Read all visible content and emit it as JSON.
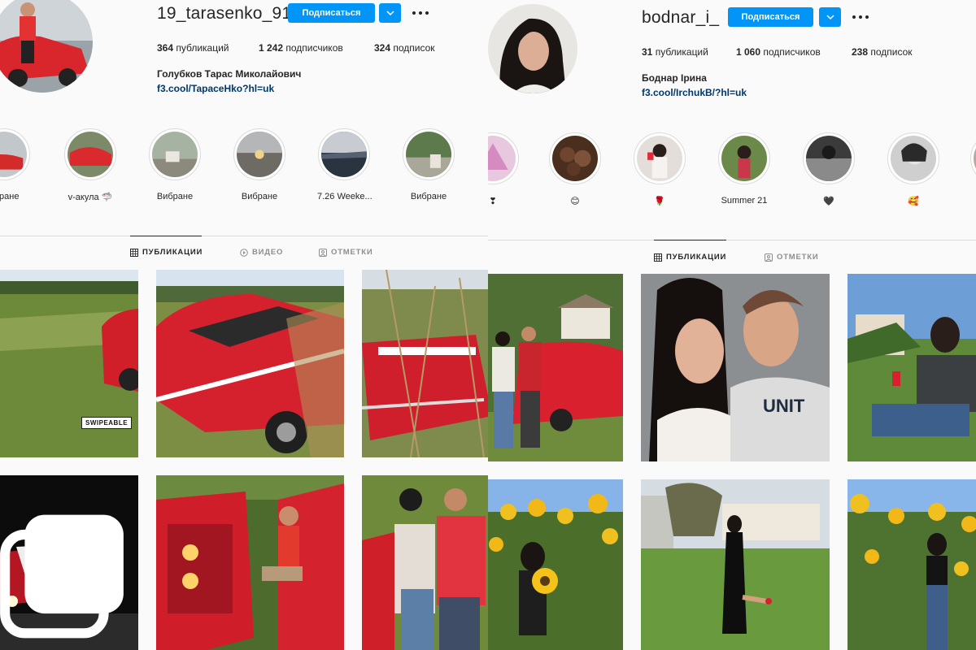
{
  "left": {
    "username": "19_tarasenko_91",
    "follow_label": "Подписаться",
    "stats": [
      {
        "value": "364",
        "label": "публикаций"
      },
      {
        "value": "1 242",
        "label": "подписчиков"
      },
      {
        "value": "324",
        "label": "подписок"
      }
    ],
    "full_name": "Голубков Тарас Миколайович",
    "bio_link": "f3.cool/TapaceHko?hl=uk",
    "highlights": [
      {
        "label": "ибране"
      },
      {
        "label": "v-акула 🦈"
      },
      {
        "label": "Вибране"
      },
      {
        "label": "Вибране"
      },
      {
        "label": "7.26 Weeke..."
      },
      {
        "label": "Вибране"
      }
    ],
    "tabs": [
      {
        "label": "ПУБЛИКАЦИИ",
        "icon": "grid-icon",
        "active": true
      },
      {
        "label": "ВИДЕО",
        "icon": "video-icon",
        "active": false
      },
      {
        "label": "ОТМЕТКИ",
        "icon": "tag-icon",
        "active": false
      }
    ],
    "sticker": "SWIPEABLE"
  },
  "right": {
    "username": "bodnar_i_",
    "follow_label": "Подписаться",
    "stats": [
      {
        "value": "31",
        "label": "публикаций"
      },
      {
        "value": "1 060",
        "label": "подписчиков"
      },
      {
        "value": "238",
        "label": "подписок"
      }
    ],
    "full_name": "Боднар Ірина",
    "bio_link": "f3.cool/IrchukB/?hl=uk",
    "highlights": [
      {
        "label": "❣"
      },
      {
        "label": "😊"
      },
      {
        "label": "🌹"
      },
      {
        "label": "Summer 21"
      },
      {
        "label": "🖤"
      },
      {
        "label": "🥰"
      }
    ],
    "tabs": [
      {
        "label": "ПУБЛИКАЦИИ",
        "icon": "grid-icon",
        "active": true
      },
      {
        "label": "ОТМЕТКИ",
        "icon": "tag-icon",
        "active": false
      }
    ]
  },
  "colors": {
    "accent": "#0095f6",
    "link": "#00376b",
    "border": "#dbdbdb",
    "muted": "#8e8e8e"
  }
}
